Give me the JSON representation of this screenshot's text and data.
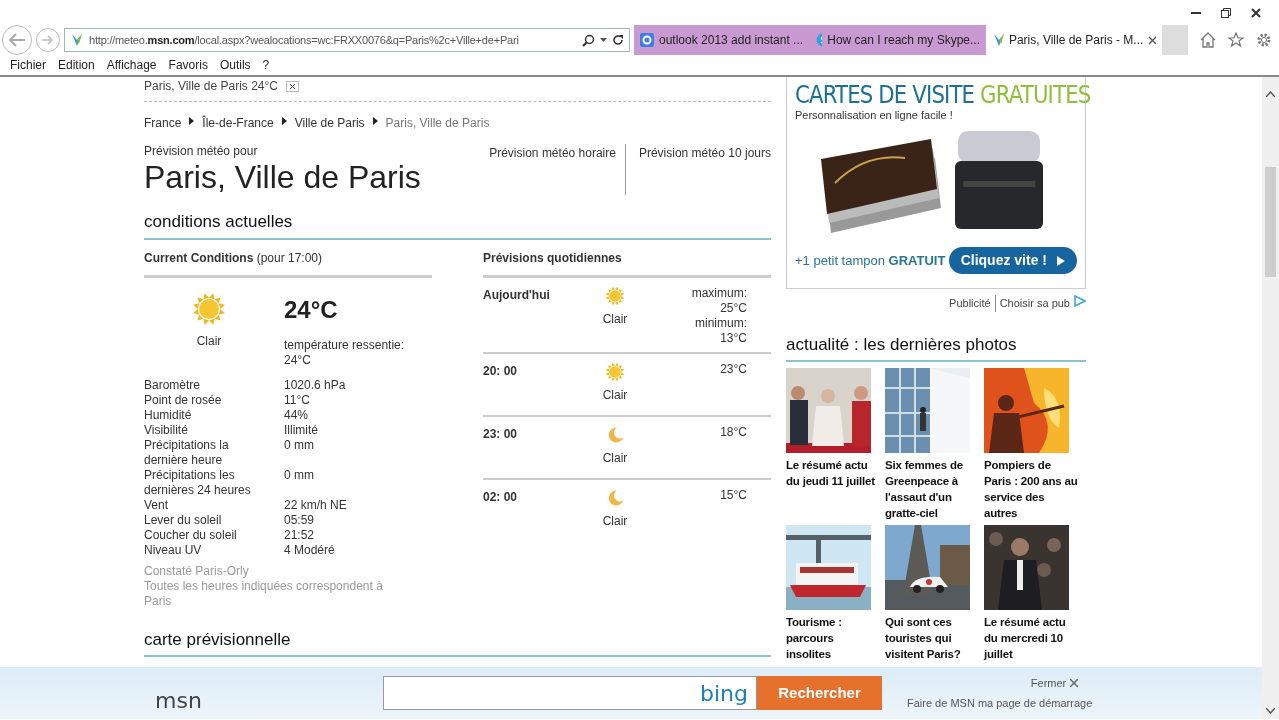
{
  "address_bar": {
    "url": "http://meteo.**msn.com**/local.aspx?wealocations=wc:FRXX0076&q=Paris%2c+Ville+de+Pari"
  },
  "tabs": [
    {
      "label": "outlook 2013 add instant ...",
      "selected": false
    },
    {
      "label": "How can I reach my Skype...",
      "selected": false
    },
    {
      "label": "Paris, Ville de Paris - M...",
      "selected": true
    }
  ],
  "menu": [
    "Fichier",
    "Edition",
    "Affichage",
    "Favoris",
    "Outils",
    "?"
  ],
  "page": {
    "location_strip": "Paris, Ville de Paris 24°C",
    "breadcrumb": [
      {
        "label": "France",
        "current": false
      },
      {
        "label": "Île-de-France",
        "current": false
      },
      {
        "label": "Ville de Paris",
        "current": false
      },
      {
        "label": "Paris, Ville de Paris",
        "current": true
      }
    ],
    "forecast_for": "Prévision météo pour",
    "city": "Paris, Ville de Paris",
    "forecast_links": [
      "Prévision météo horaire",
      "Prévision météo 10 jours"
    ],
    "current_section": "conditions actuelles",
    "current": {
      "heading": "**Current Conditions** (pour 17:00)",
      "kind": "sun",
      "condition": "Clair",
      "temperature": "24°C",
      "feels_like": "température ressentie: 24°C",
      "details": [
        {
          "label": "Baromètre",
          "value": "1020.6 hPa"
        },
        {
          "label": "Point de rosée",
          "value": "11°C"
        },
        {
          "label": "Humidité",
          "value": "44%"
        },
        {
          "label": "Visibilité",
          "value": "Illimité"
        },
        {
          "label": "Précipitations la dernière heure",
          "value": "0 mm"
        },
        {
          "label": "Précipitations les dernières 24 heures",
          "value": "0 mm"
        },
        {
          "label": "Vent",
          "value": "22 km/h NE"
        },
        {
          "label": "Lever du soleil",
          "value": "05:59"
        },
        {
          "label": "Coucher du soleil",
          "value": "21:52"
        },
        {
          "label": "Niveau UV",
          "value": "4 Modéré"
        }
      ],
      "notes": [
        "Constaté Paris-Orly",
        "Toutes les heures indiquées correspondent à Paris"
      ]
    },
    "daily": {
      "heading": "Prévisions quotidiennes",
      "rows": [
        {
          "label": "Aujourd'hui",
          "kind": "sun",
          "condition": "Clair",
          "temps": [
            "maximum:",
            "25°C",
            "minimum:",
            "13°C"
          ]
        },
        {
          "label": "20: 00",
          "kind": "sun",
          "condition": "Clair",
          "temps": [
            "23°C"
          ]
        },
        {
          "label": "23: 00",
          "kind": "moon",
          "condition": "Clair",
          "temps": [
            "18°C"
          ]
        },
        {
          "label": "02: 00",
          "kind": "moon",
          "condition": "Clair",
          "temps": [
            "15°C"
          ]
        }
      ]
    },
    "map_section": "carte prévisionnelle",
    "ad": {
      "title_main": "CARTES DE VISITE",
      "title_accent": "GRATUITES",
      "subtitle": "Personnalisation en ligne facile !",
      "promo": "+1 petit tampon **GRATUIT**",
      "button": "Cliquez vite !",
      "footer": [
        "Publicité",
        "Choisir sa pub"
      ]
    },
    "photos": {
      "heading": "actualité : les dernières photos",
      "items": [
        {
          "caption": "Le résumé actu du jeudi 11 juillet"
        },
        {
          "caption": "Six femmes de Greenpeace à l'assaut d'un gratte-ciel"
        },
        {
          "caption": "Pompiers de Paris : 200 ans au service des autres"
        },
        {
          "caption": "Tourisme : parcours insolites"
        },
        {
          "caption": "Qui sont ces touristes qui visitent Paris?"
        },
        {
          "caption": "Le résumé actu du mercredi 10 juillet"
        }
      ]
    }
  },
  "bing_bar": {
    "logo": "msn",
    "search_logo": "bing",
    "button": "Rechercher",
    "close": "Fermer",
    "homepage_link": "Faire de MSN ma page de démarrage"
  }
}
